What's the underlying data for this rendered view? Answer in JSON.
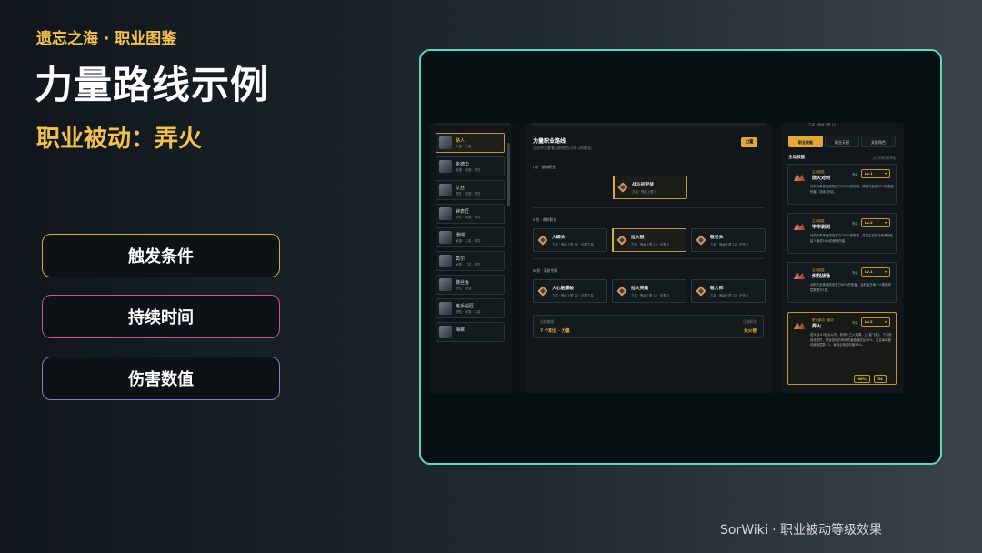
{
  "slide": {
    "kicker": "遗忘之海 · 职业图鉴",
    "title": "力量路线示例",
    "subtitle": "职业被动：弄火",
    "attributes": [
      "触发条件",
      "持续时间",
      "伤害数值"
    ],
    "footer": "SorWiki · 职业被动等级效果",
    "colors": {
      "accent": "#f2c14e",
      "frame": "#5fd6c0",
      "attr1": "#d9a93a",
      "attr2": "#d04f9a",
      "attr3": "#8a7ad8"
    }
  },
  "app": {
    "characters": [
      {
        "name": "路人",
        "tags": "力量 · 力量",
        "active": true
      },
      {
        "name": "金德华",
        "tags": "敏捷 · 敏捷 · 理性"
      },
      {
        "name": "艾丝",
        "tags": "理性 · 敏捷 · 理性"
      },
      {
        "name": "钟表匠",
        "tags": "理性 · 敏捷 · 理性"
      },
      {
        "name": "珊瑚",
        "tags": "敏捷 · 力量 · 理性"
      },
      {
        "name": "莫尔",
        "tags": "敏捷 · 力量 · 理性"
      },
      {
        "name": "撒丝鱼",
        "tags": "理性 · 敏捷"
      },
      {
        "name": "鬼手船匠",
        "tags": "理性 · 敏捷 · 力量"
      },
      {
        "name": "海螺",
        "tags": ""
      }
    ],
    "path": {
      "title": "力量职业路线",
      "desc": "点击节点查看当前角色可学习的职业。",
      "badge": "力量",
      "tiers": [
        {
          "label": "I 阶 · 基础职业",
          "nodes": [
            {
              "name": "战斗初学徒",
              "info": "力量 · 等级上限 5",
              "active": true
            }
          ]
        },
        {
          "label": "II 阶 · 进阶职业",
          "nodes": [
            {
              "name": "大榔头",
              "info": "力量 · 等级上限 10 · 前置力量",
              "active": false
            },
            {
              "name": "拉火棍",
              "info": "力量 · 等级上限 10 · 前置 5",
              "active": true
            },
            {
              "name": "敬老头",
              "info": "力量 · 等级上限 10 · 护佑 5",
              "active": false
            }
          ]
        },
        {
          "label": "III 阶 · 高阶专精",
          "nodes": [
            {
              "name": "大心脏爆破",
              "info": "力量 · 等级上限 20 · 前置力量",
              "active": false
            },
            {
              "name": "拉火英雄",
              "info": "力量 · 等级上限 10 · 前置 5",
              "active": false
            },
            {
              "name": "敬大师",
              "info": "力量 · 等级上限 10 · 护佑 5",
              "active": false
            }
          ]
        }
      ],
      "summary": {
        "label": "当前路线",
        "value": "7 个职业 · 力量",
        "status": "已选职业",
        "end": "拉火棍"
      }
    },
    "skills": {
      "topline": "力量 · 等级上限 10",
      "tabs": [
        {
          "label": "职业技能",
          "active": true
        },
        {
          "label": "职业天赋"
        },
        {
          "label": "关联角色"
        }
      ],
      "section": "主动技能",
      "hint": "点击切换技能等级",
      "level_label": "等级",
      "cards": [
        {
          "tag": "主动技能",
          "name": "烧火对刺",
          "level": "Lv.1",
          "desc": "对前方单体造成攻击力120%的伤害，并额外造成50%的燃烧伤害，持续1回合。"
        },
        {
          "tag": "主动技能",
          "name": "毕毕剥剥",
          "level": "Lv.2",
          "desc": "对前方单体造成攻击力100%的伤害，并对主目标与其两侧各敌人造成50%的燃烧伤害。"
        },
        {
          "tag": "主动技能",
          "name": "炽烈战场",
          "level": "Lv.1",
          "desc": "对前方全体造成攻击力60%的伤害，当前敌方每个人物燃烧层数提升1层。"
        },
        {
          "tag": "职业被动 · 被动",
          "name": "弄火",
          "level": "Lv.2",
          "desc": "若大战斗3回合以内，获得火之火效果，[火星飞溅]：下次使用技能时，把该技能的燃烧伤害值翻倍至48%，并且每局被动燃烧层数+2，每回合造成伤害54%。",
          "active": true,
          "chips": [
            "48%",
            "54"
          ]
        }
      ]
    }
  }
}
